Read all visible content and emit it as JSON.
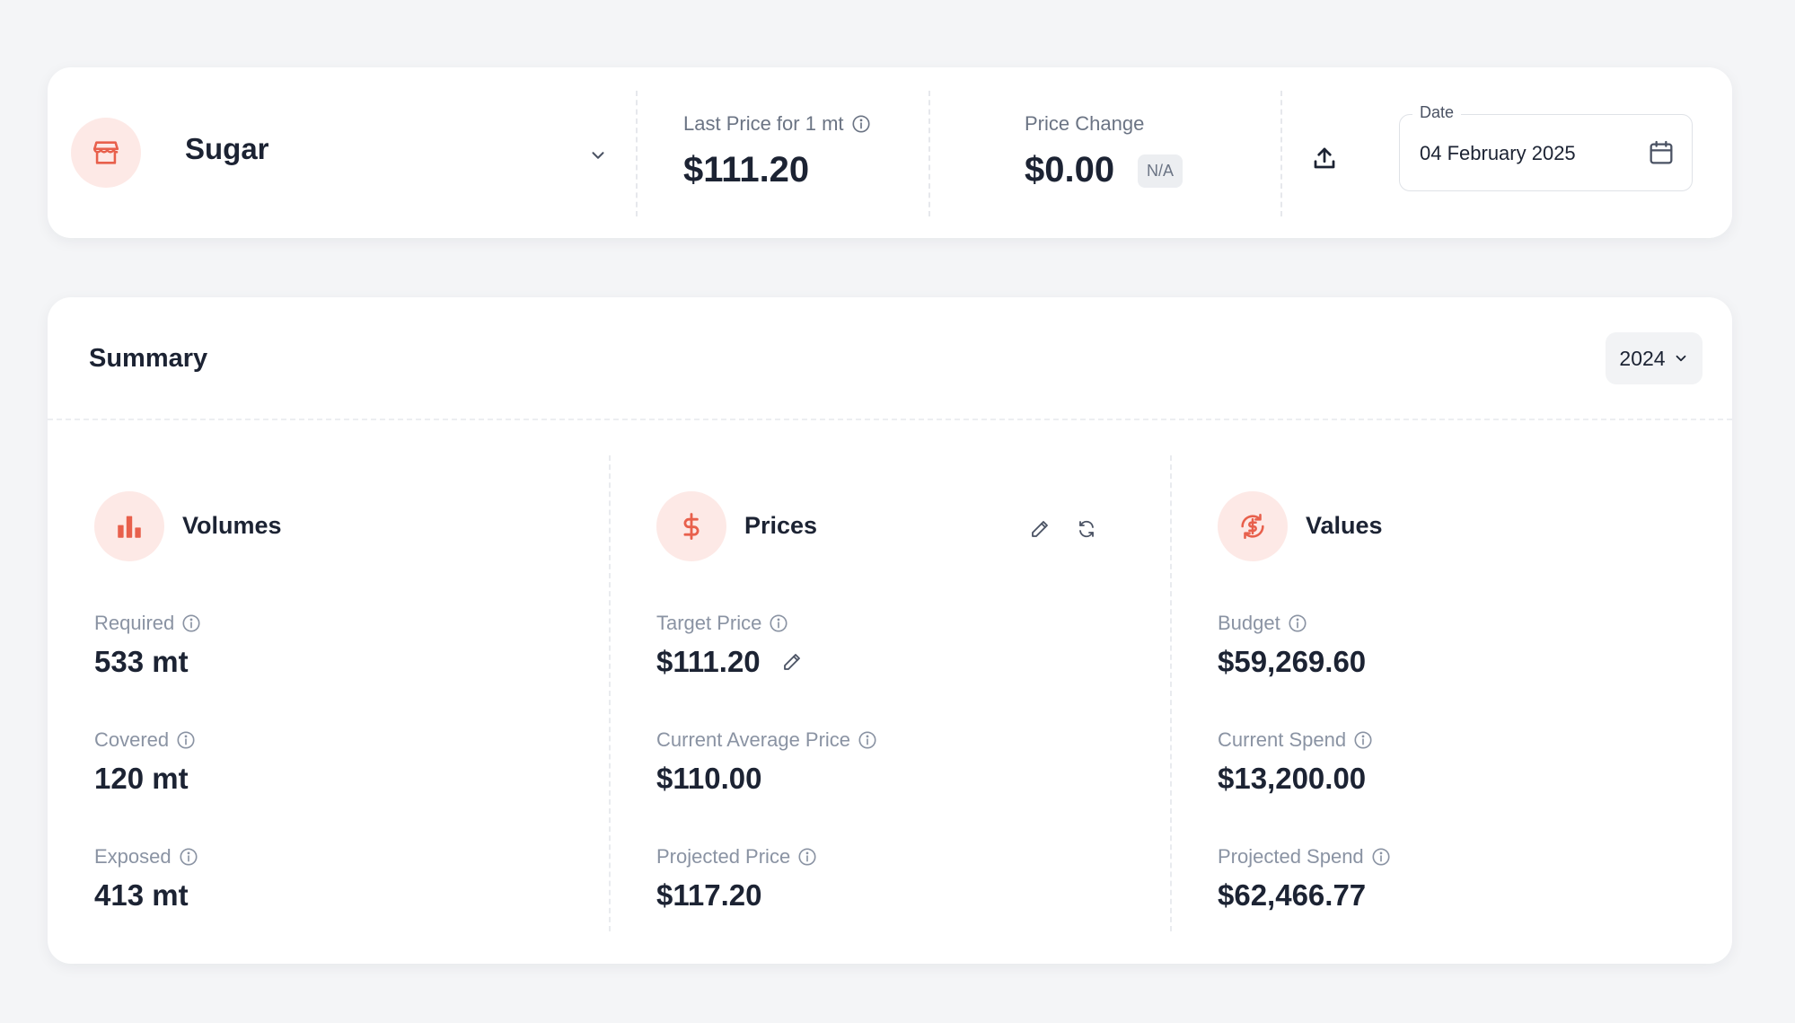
{
  "header": {
    "commodity": "Sugar",
    "last_price_label": "Last Price for 1 mt",
    "last_price_value": "$111.20",
    "price_change_label": "Price Change",
    "price_change_value": "$0.00",
    "price_change_badge": "N/A",
    "date_label": "Date",
    "date_value": "04 February 2025"
  },
  "summary": {
    "title": "Summary",
    "year": "2024",
    "volumes": {
      "title": "Volumes",
      "required_label": "Required",
      "required_value": "533 mt",
      "covered_label": "Covered",
      "covered_value": "120 mt",
      "exposed_label": "Exposed",
      "exposed_value": "413 mt"
    },
    "prices": {
      "title": "Prices",
      "target_label": "Target Price",
      "target_value": "$111.20",
      "current_avg_label": "Current Average Price",
      "current_avg_value": "$110.00",
      "projected_label": "Projected Price",
      "projected_value": "$117.20"
    },
    "values": {
      "title": "Values",
      "budget_label": "Budget",
      "budget_value": "$59,269.60",
      "current_spend_label": "Current Spend",
      "current_spend_value": "$13,200.00",
      "projected_spend_label": "Projected Spend",
      "projected_spend_value": "$62,466.77"
    }
  },
  "colors": {
    "accent": "#e8604c",
    "accent_bg": "#fde9e6",
    "text_dark": "#1c2333",
    "text_muted": "#8a93a3"
  },
  "icons": {
    "commodity": "store-icon",
    "volumes": "bar-chart-icon",
    "prices": "dollar-icon",
    "values": "dollar-cycle-icon",
    "info": "info-icon",
    "upload": "upload-icon",
    "calendar": "calendar-icon",
    "edit": "pencil-icon",
    "refresh": "refresh-icon"
  }
}
